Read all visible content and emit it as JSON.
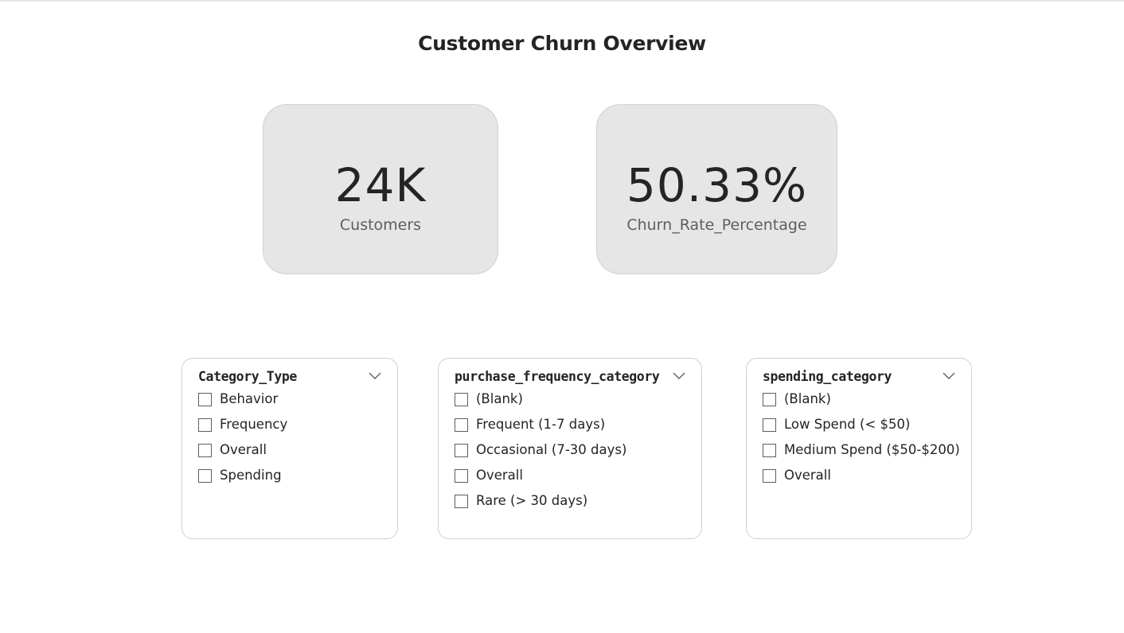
{
  "page": {
    "title": "Customer Churn Overview"
  },
  "cards": {
    "customers": {
      "value": "24K",
      "label": "Customers"
    },
    "churn_rate": {
      "value": "50.33%",
      "label": "Churn_Rate_Percentage"
    }
  },
  "slicers": {
    "category_type": {
      "title": "Category_Type",
      "items": [
        "Behavior",
        "Frequency",
        "Overall",
        "Spending"
      ]
    },
    "purchase_frequency": {
      "title": "purchase_frequency_category",
      "items": [
        "(Blank)",
        "Frequent (1-7 days)",
        "Occasional (7-30 days)",
        "Overall",
        "Rare (> 30 days)"
      ]
    },
    "spending": {
      "title": "spending_category",
      "items": [
        "(Blank)",
        "Low Spend (< $50)",
        "Medium Spend ($50-$200)",
        "Overall"
      ]
    }
  },
  "icons": {
    "dropdown": "chevron-down-icon",
    "checkbox": "checkbox-unchecked"
  },
  "colors": {
    "card_background": "#e6e6e6",
    "text_primary": "#252423",
    "text_secondary": "#605e5c",
    "border": "#d0d0d0"
  }
}
